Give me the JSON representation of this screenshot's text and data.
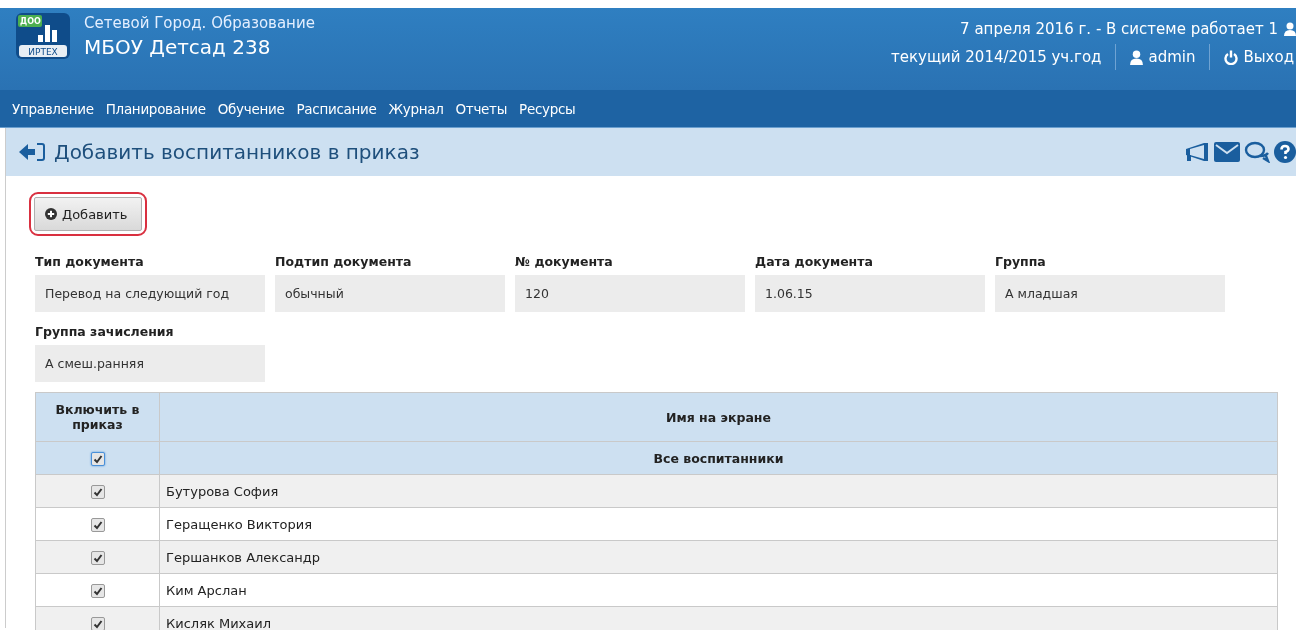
{
  "header": {
    "logo_top": "ДОО",
    "logo_bottom": "ИРТЕХ",
    "system_name": "Сетевой Город. Образование",
    "school": "МБОУ Детсад 238",
    "date_info": "7 апреля 2016 г. - В системе работает 1",
    "year": "текущий 2014/2015 уч.год",
    "user": "admin",
    "logout": "Выход"
  },
  "nav": [
    "Управление",
    "Планирование",
    "Обучение",
    "Расписание",
    "Журнал",
    "Отчеты",
    "Ресурсы"
  ],
  "page_title": "Добавить воспитанников в приказ",
  "add_button": {
    "label": "Добавить",
    "highlighted": true
  },
  "fields": [
    {
      "label": "Тип документа",
      "value": "Перевод на следующий год"
    },
    {
      "label": "Подтип документа",
      "value": "обычный"
    },
    {
      "label": "№ документа",
      "value": "120"
    },
    {
      "label": "Дата документа",
      "value": "1.06.15"
    },
    {
      "label": "Группа",
      "value": "А младшая"
    },
    {
      "label": "Группа зачисления",
      "value": "А смеш.ранняя"
    }
  ],
  "table": {
    "columns": [
      "Включить в приказ",
      "Имя на экране"
    ],
    "select_all": {
      "label": "Все воспитанники",
      "checked": true
    },
    "rows": [
      {
        "name": "Бутурова София",
        "checked": true
      },
      {
        "name": "Геращенко Виктория",
        "checked": true
      },
      {
        "name": "Гершанков Александр",
        "checked": true
      },
      {
        "name": "Ким Арслан",
        "checked": true
      },
      {
        "name": "Кисляк Михаил",
        "checked": true
      }
    ]
  }
}
